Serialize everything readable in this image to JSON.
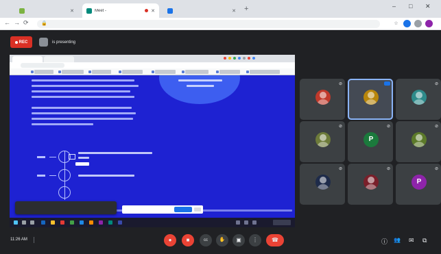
{
  "browser": {
    "tabs": [
      {
        "label": "",
        "color": "#7cb342"
      },
      {
        "label": "Meet - ",
        "color": "#00897b"
      },
      {
        "label": "",
        "color": "#1a73e8"
      }
    ],
    "new_tab": "+",
    "window_controls": {
      "minimize": "–",
      "maximize": "□",
      "close": "✕"
    },
    "address": ""
  },
  "meet": {
    "recording_label": "REC",
    "presenter_text": "is presenting",
    "participants": [
      {
        "name": "",
        "color": "#c0392b",
        "initial": ""
      },
      {
        "name": "",
        "color": "#b8860b",
        "initial": ""
      },
      {
        "name": "",
        "color": "#2e8b8b",
        "initial": ""
      },
      {
        "name": "",
        "color": "#6d7b3a",
        "initial": ""
      },
      {
        "name": "",
        "color": "#1b7a3c",
        "initial": "P"
      },
      {
        "name": "",
        "color": "#5c7a2a",
        "initial": ""
      },
      {
        "name": "",
        "color": "#1e2b4a",
        "initial": ""
      },
      {
        "name": "",
        "color": "#7a1f2a",
        "initial": ""
      },
      {
        "name": "",
        "color": "#8e24aa",
        "initial": "P"
      }
    ],
    "bottom": {
      "time": "11:26 AM",
      "meeting_code": ""
    },
    "controls": [
      {
        "name": "mic-off-button",
        "icon": "mic-off-icon",
        "glyph": "●"
      },
      {
        "name": "camera-off-button",
        "icon": "camera-off-icon",
        "glyph": "■"
      },
      {
        "name": "captions-button",
        "icon": "captions-icon",
        "glyph": "cc"
      },
      {
        "name": "raise-hand-button",
        "icon": "hand-icon",
        "glyph": "✋"
      },
      {
        "name": "present-button",
        "icon": "present-icon",
        "glyph": "▣"
      },
      {
        "name": "more-options-button",
        "icon": "more-icon",
        "glyph": "⋮"
      },
      {
        "name": "leave-call-button",
        "icon": "phone-end-icon",
        "glyph": "☎"
      }
    ],
    "side_icons": [
      {
        "name": "info-icon",
        "glyph": "ⓘ"
      },
      {
        "name": "people-icon",
        "glyph": "👥"
      },
      {
        "name": "chat-icon",
        "glyph": "✉"
      },
      {
        "name": "activities-icon",
        "glyph": "⧉"
      }
    ],
    "presentation_toast": "",
    "colors": {
      "background": "#202124",
      "tile": "#3c4043",
      "danger": "#ea4335",
      "slide_blue": "#1e22d2",
      "accent": "#8ab4f8"
    }
  }
}
